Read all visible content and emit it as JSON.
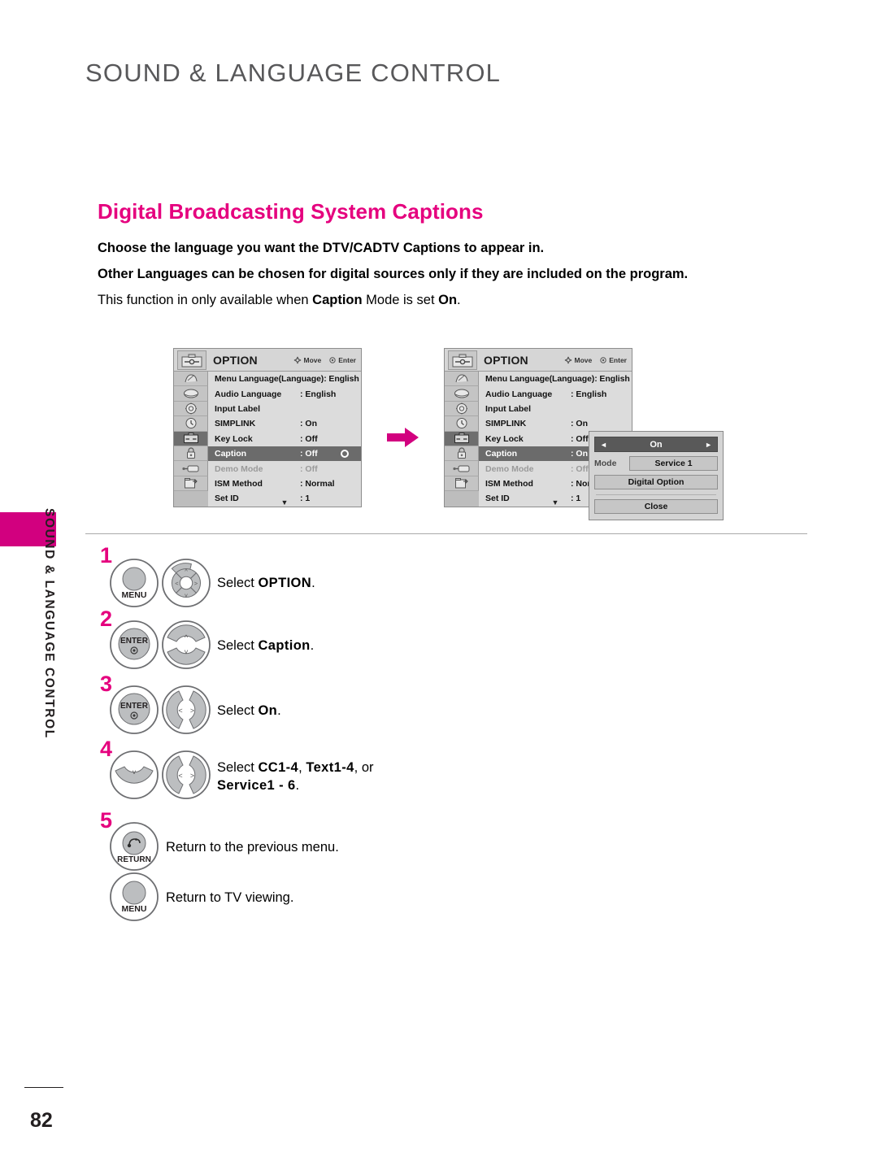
{
  "page": {
    "header_title": "SOUND & LANGUAGE CONTROL",
    "sidebar_label": "SOUND & LANGUAGE CONTROL",
    "page_number": "82"
  },
  "section": {
    "heading": "Digital Broadcasting System Captions",
    "paragraphs": [
      "Choose the language you want the DTV/CADTV Captions to appear in.",
      "Other Languages can be chosen for digital sources only if they are included on the program."
    ],
    "note": {
      "pre": "This function in only available when ",
      "bold1": "Caption",
      "mid": " Mode is set ",
      "bold2": "On",
      "post": "."
    }
  },
  "osd": {
    "title": "OPTION",
    "hint_move": "Move",
    "hint_enter": "Enter",
    "rows": [
      {
        "label": "Menu Language(Language): English",
        "value": "",
        "state": "normal",
        "wide": true
      },
      {
        "label": "Audio Language",
        "value": ": English",
        "state": "normal"
      },
      {
        "label": "Input Label",
        "value": "",
        "state": "normal"
      },
      {
        "label": "SIMPLINK",
        "value": ": On",
        "state": "normal"
      },
      {
        "label": "Key Lock",
        "value": ": Off",
        "state": "normal"
      },
      {
        "label": "Caption",
        "value": ": Off",
        "state": "selected"
      },
      {
        "label": "Demo Mode",
        "value": ": Off",
        "state": "disabled"
      },
      {
        "label": "ISM Method",
        "value": ": Normal",
        "state": "normal"
      },
      {
        "label": "Set ID",
        "value": ": 1",
        "state": "normal"
      }
    ],
    "rows_second": [
      {
        "label": "Menu Language(Language): English",
        "value": "",
        "state": "normal",
        "wide": true
      },
      {
        "label": "Audio Language",
        "value": ": English",
        "state": "normal"
      },
      {
        "label": "Input Label",
        "value": "",
        "state": "normal"
      },
      {
        "label": "SIMPLINK",
        "value": ": On",
        "state": "normal"
      },
      {
        "label": "Key Lock",
        "value": ": Off",
        "state": "normal"
      },
      {
        "label": "Caption",
        "value": ": On",
        "state": "selected"
      },
      {
        "label": "Demo Mode",
        "value": ": Off",
        "state": "disabled"
      },
      {
        "label": "ISM Method",
        "value": ": Normal",
        "state": "normal"
      },
      {
        "label": "Set ID",
        "value": ": 1",
        "state": "normal"
      }
    ],
    "scroll_caret": "▼",
    "icons": [
      "picture-icon",
      "screen-icon",
      "audio-icon",
      "time-icon",
      "option-icon",
      "lock-icon",
      "input-icon",
      "usb-icon"
    ]
  },
  "popup": {
    "value": "On",
    "arrow_left": "◄",
    "arrow_right": "►",
    "mode_label": "Mode",
    "mode_value": "Service 1",
    "digital_option": "Digital Option",
    "close": "Close"
  },
  "steps": [
    {
      "number": "1",
      "buttons": [
        "menu-button",
        "dpad-button"
      ],
      "button_labels": [
        "MENU",
        ""
      ],
      "text_pre": "Select ",
      "text_bold": "OPTION",
      "text_post": "."
    },
    {
      "number": "2",
      "buttons": [
        "enter-button",
        "updown-button"
      ],
      "button_labels": [
        "ENTER",
        ""
      ],
      "text_pre": "Select ",
      "text_bold": "Caption",
      "text_post": "."
    },
    {
      "number": "3",
      "buttons": [
        "enter-button",
        "leftright-button"
      ],
      "button_labels": [
        "ENTER",
        ""
      ],
      "text_pre": "Select ",
      "text_bold": "On",
      "text_post": "."
    },
    {
      "number": "4",
      "buttons": [
        "down-button",
        "leftright-button"
      ],
      "button_labels": [
        "",
        ""
      ],
      "text_pre": "Select ",
      "text_bold": "CC1-4",
      "text_mid1": ", ",
      "text_bold2": "Text1-4",
      "text_mid2": ", or ",
      "text_bold3": "Service1 - 6",
      "text_post": "."
    },
    {
      "number": "5",
      "buttons": [
        "return-button"
      ],
      "button_labels": [
        "RETURN"
      ],
      "text_pre": "Return to the previous menu.",
      "text_bold": "",
      "text_post": ""
    },
    {
      "number": "",
      "buttons": [
        "menu-button"
      ],
      "button_labels": [
        "MENU"
      ],
      "text_pre": "Return to TV viewing.",
      "text_bold": "",
      "text_post": ""
    }
  ],
  "colors": {
    "accent_pink": "#e5007e",
    "tab_pink": "#d2007f",
    "header_gray": "#58585a",
    "osd_bg": "#d6d6d6",
    "osd_selected": "#6b6b6b"
  }
}
